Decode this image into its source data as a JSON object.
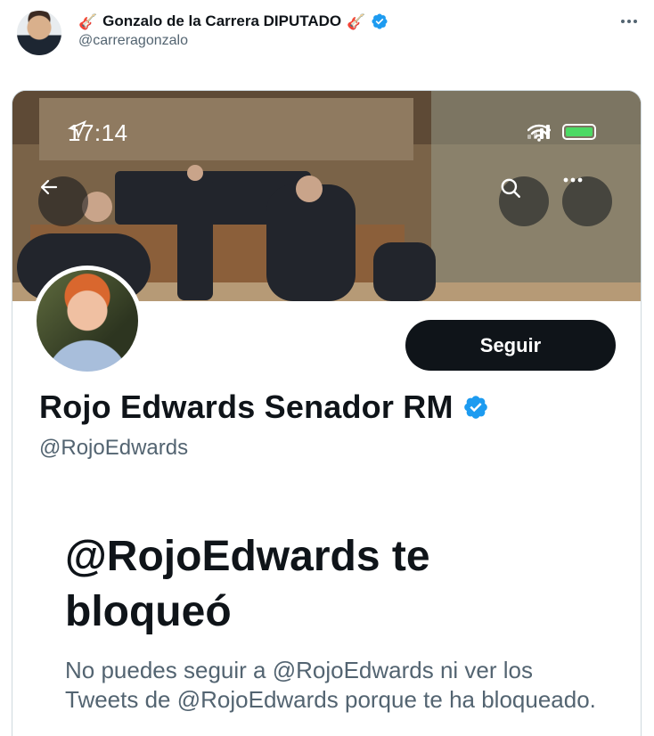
{
  "tweet": {
    "author_name": "Gonzalo de la Carrera DIPUTADO",
    "author_handle": "@carreragonzalo",
    "name_emoji": "🎸",
    "verified_color": "#1d9bf0"
  },
  "screenshot": {
    "status_time": "17:14",
    "battery_color": "#4cd964",
    "follow_label": "Seguir",
    "profile_name": "Rojo Edwards Senador RM",
    "profile_handle": "@RojoEdwards",
    "blocked_title": "@RojoEdwards te bloqueó",
    "blocked_description": "No puedes seguir a @RojoEdwards ni ver los Tweets de @RojoEdwards porque te ha bloqueado."
  },
  "icons": [
    "more-icon",
    "verified-badge-icon",
    "guitar-icon",
    "location-arrow-icon",
    "wifi-icon",
    "battery-icon",
    "back-arrow-icon",
    "search-icon",
    "more-icon"
  ]
}
